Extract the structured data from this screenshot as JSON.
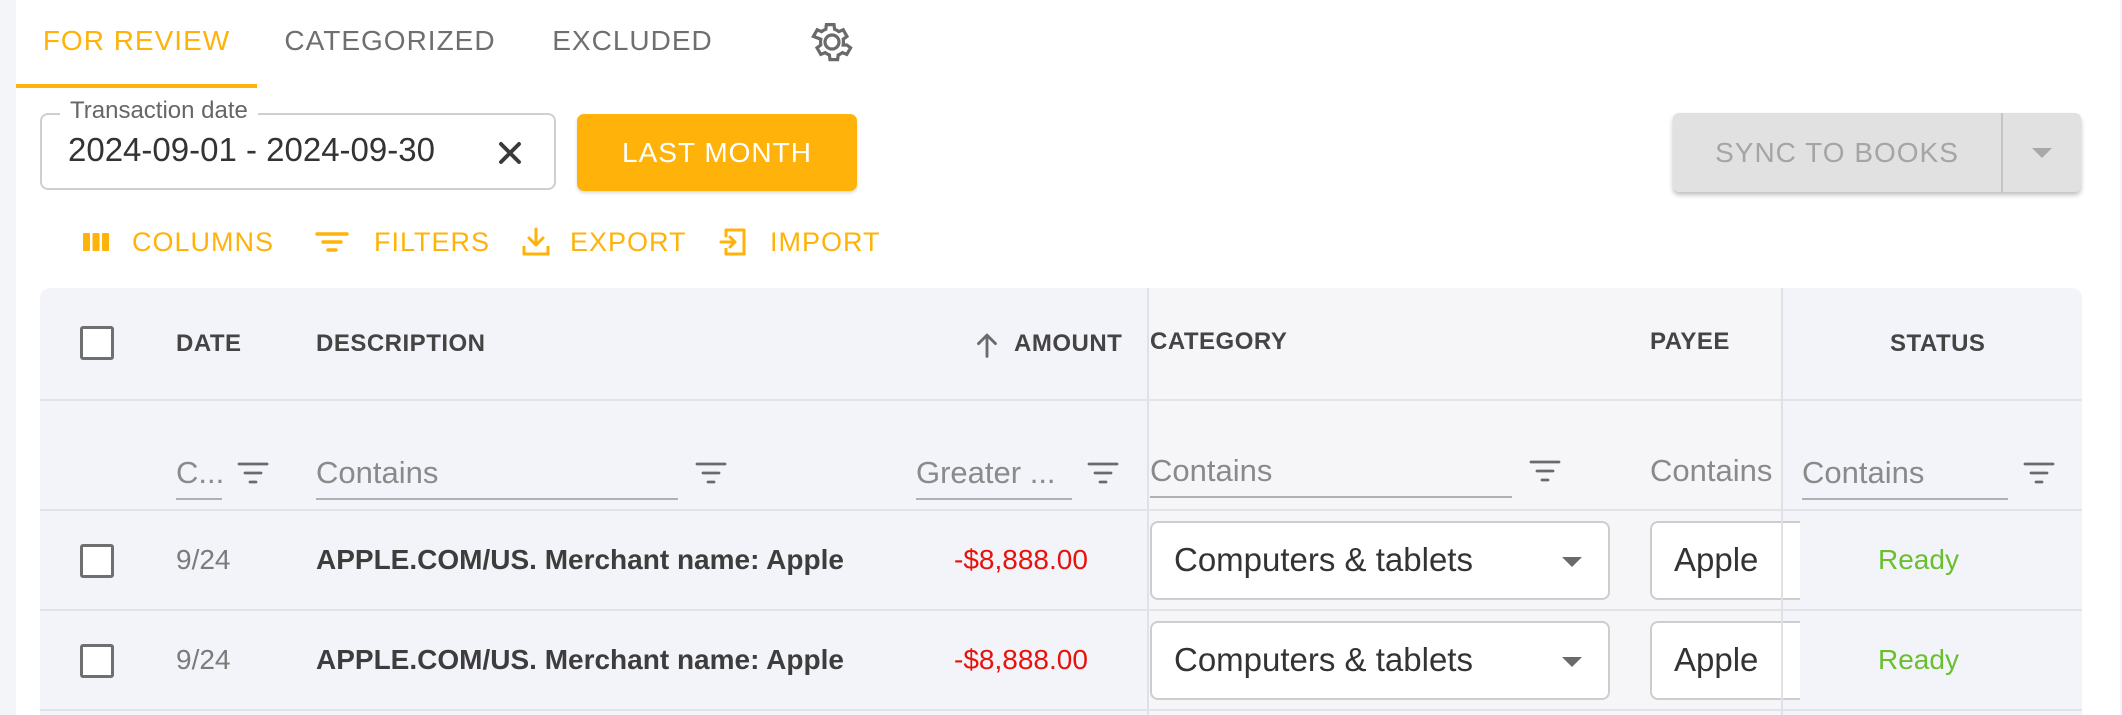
{
  "tabs": [
    {
      "label": "FOR REVIEW",
      "active": true
    },
    {
      "label": "CATEGORIZED",
      "active": false
    },
    {
      "label": "EXCLUDED",
      "active": false
    }
  ],
  "date_filter": {
    "label": "Transaction date",
    "value": "2024-09-01 - 2024-09-30"
  },
  "last_month_button": "LAST MONTH",
  "sync_button": "SYNC TO BOOKS",
  "toolbar": {
    "columns": "COLUMNS",
    "filters": "FILTERS",
    "export": "EXPORT",
    "import": "IMPORT"
  },
  "columns": {
    "date": "DATE",
    "description": "DESCRIPTION",
    "amount": "AMOUNT",
    "category": "CATEGORY",
    "payee": "PAYEE",
    "status": "STATUS"
  },
  "column_filters": {
    "date": "C...",
    "description": "Contains",
    "amount": "Greater ...",
    "category": "Contains",
    "payee": "Contains",
    "status": "Contains"
  },
  "rows": [
    {
      "date": "9/24",
      "description": "APPLE.COM/US. Merchant name: Apple",
      "amount": "-$8,888.00",
      "category": "Computers & tablets",
      "payee": "Apple",
      "status": "Ready"
    },
    {
      "date": "9/24",
      "description": "APPLE.COM/US. Merchant name: Apple",
      "amount": "-$8,888.00",
      "category": "Computers & tablets",
      "payee": "Apple",
      "status": "Ready"
    }
  ],
  "colors": {
    "accent": "#ffb20a",
    "negative": "#e8120c",
    "ready": "#6abf2f"
  }
}
